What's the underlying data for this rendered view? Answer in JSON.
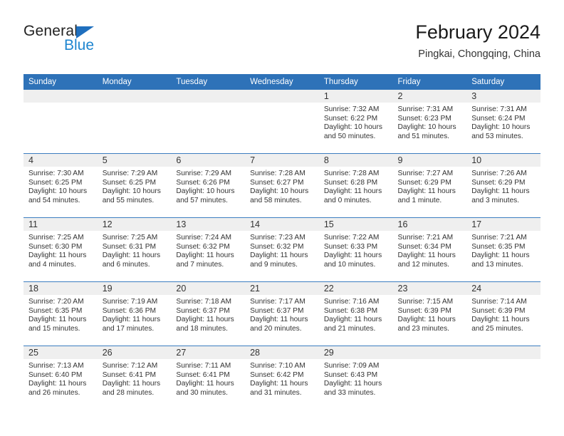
{
  "logo": {
    "word_top": "General",
    "word_bottom": "Blue",
    "triangle_color": "#1F6FBE",
    "blue_text_color": "#1F86D0"
  },
  "header": {
    "title": "February 2024",
    "subtitle": "Pingkai, Chongqing, China"
  },
  "theme": {
    "header_blue": "#2E72B8",
    "row_divider_blue": "#3C7EC0",
    "date_band_gray": "#EFEFEF",
    "text_color": "#333333"
  },
  "calendar": {
    "weekdays": [
      "Sunday",
      "Monday",
      "Tuesday",
      "Wednesday",
      "Thursday",
      "Friday",
      "Saturday"
    ],
    "weeks": [
      [
        {
          "date": "",
          "lines": []
        },
        {
          "date": "",
          "lines": []
        },
        {
          "date": "",
          "lines": []
        },
        {
          "date": "",
          "lines": []
        },
        {
          "date": "1",
          "lines": [
            "Sunrise: 7:32 AM",
            "Sunset: 6:22 PM",
            "Daylight: 10 hours and 50 minutes."
          ]
        },
        {
          "date": "2",
          "lines": [
            "Sunrise: 7:31 AM",
            "Sunset: 6:23 PM",
            "Daylight: 10 hours and 51 minutes."
          ]
        },
        {
          "date": "3",
          "lines": [
            "Sunrise: 7:31 AM",
            "Sunset: 6:24 PM",
            "Daylight: 10 hours and 53 minutes."
          ]
        }
      ],
      [
        {
          "date": "4",
          "lines": [
            "Sunrise: 7:30 AM",
            "Sunset: 6:25 PM",
            "Daylight: 10 hours and 54 minutes."
          ]
        },
        {
          "date": "5",
          "lines": [
            "Sunrise: 7:29 AM",
            "Sunset: 6:25 PM",
            "Daylight: 10 hours and 55 minutes."
          ]
        },
        {
          "date": "6",
          "lines": [
            "Sunrise: 7:29 AM",
            "Sunset: 6:26 PM",
            "Daylight: 10 hours and 57 minutes."
          ]
        },
        {
          "date": "7",
          "lines": [
            "Sunrise: 7:28 AM",
            "Sunset: 6:27 PM",
            "Daylight: 10 hours and 58 minutes."
          ]
        },
        {
          "date": "8",
          "lines": [
            "Sunrise: 7:28 AM",
            "Sunset: 6:28 PM",
            "Daylight: 11 hours and 0 minutes."
          ]
        },
        {
          "date": "9",
          "lines": [
            "Sunrise: 7:27 AM",
            "Sunset: 6:29 PM",
            "Daylight: 11 hours and 1 minute."
          ]
        },
        {
          "date": "10",
          "lines": [
            "Sunrise: 7:26 AM",
            "Sunset: 6:29 PM",
            "Daylight: 11 hours and 3 minutes."
          ]
        }
      ],
      [
        {
          "date": "11",
          "lines": [
            "Sunrise: 7:25 AM",
            "Sunset: 6:30 PM",
            "Daylight: 11 hours and 4 minutes."
          ]
        },
        {
          "date": "12",
          "lines": [
            "Sunrise: 7:25 AM",
            "Sunset: 6:31 PM",
            "Daylight: 11 hours and 6 minutes."
          ]
        },
        {
          "date": "13",
          "lines": [
            "Sunrise: 7:24 AM",
            "Sunset: 6:32 PM",
            "Daylight: 11 hours and 7 minutes."
          ]
        },
        {
          "date": "14",
          "lines": [
            "Sunrise: 7:23 AM",
            "Sunset: 6:32 PM",
            "Daylight: 11 hours and 9 minutes."
          ]
        },
        {
          "date": "15",
          "lines": [
            "Sunrise: 7:22 AM",
            "Sunset: 6:33 PM",
            "Daylight: 11 hours and 10 minutes."
          ]
        },
        {
          "date": "16",
          "lines": [
            "Sunrise: 7:21 AM",
            "Sunset: 6:34 PM",
            "Daylight: 11 hours and 12 minutes."
          ]
        },
        {
          "date": "17",
          "lines": [
            "Sunrise: 7:21 AM",
            "Sunset: 6:35 PM",
            "Daylight: 11 hours and 13 minutes."
          ]
        }
      ],
      [
        {
          "date": "18",
          "lines": [
            "Sunrise: 7:20 AM",
            "Sunset: 6:35 PM",
            "Daylight: 11 hours and 15 minutes."
          ]
        },
        {
          "date": "19",
          "lines": [
            "Sunrise: 7:19 AM",
            "Sunset: 6:36 PM",
            "Daylight: 11 hours and 17 minutes."
          ]
        },
        {
          "date": "20",
          "lines": [
            "Sunrise: 7:18 AM",
            "Sunset: 6:37 PM",
            "Daylight: 11 hours and 18 minutes."
          ]
        },
        {
          "date": "21",
          "lines": [
            "Sunrise: 7:17 AM",
            "Sunset: 6:37 PM",
            "Daylight: 11 hours and 20 minutes."
          ]
        },
        {
          "date": "22",
          "lines": [
            "Sunrise: 7:16 AM",
            "Sunset: 6:38 PM",
            "Daylight: 11 hours and 21 minutes."
          ]
        },
        {
          "date": "23",
          "lines": [
            "Sunrise: 7:15 AM",
            "Sunset: 6:39 PM",
            "Daylight: 11 hours and 23 minutes."
          ]
        },
        {
          "date": "24",
          "lines": [
            "Sunrise: 7:14 AM",
            "Sunset: 6:39 PM",
            "Daylight: 11 hours and 25 minutes."
          ]
        }
      ],
      [
        {
          "date": "25",
          "lines": [
            "Sunrise: 7:13 AM",
            "Sunset: 6:40 PM",
            "Daylight: 11 hours and 26 minutes."
          ]
        },
        {
          "date": "26",
          "lines": [
            "Sunrise: 7:12 AM",
            "Sunset: 6:41 PM",
            "Daylight: 11 hours and 28 minutes."
          ]
        },
        {
          "date": "27",
          "lines": [
            "Sunrise: 7:11 AM",
            "Sunset: 6:41 PM",
            "Daylight: 11 hours and 30 minutes."
          ]
        },
        {
          "date": "28",
          "lines": [
            "Sunrise: 7:10 AM",
            "Sunset: 6:42 PM",
            "Daylight: 11 hours and 31 minutes."
          ]
        },
        {
          "date": "29",
          "lines": [
            "Sunrise: 7:09 AM",
            "Sunset: 6:43 PM",
            "Daylight: 11 hours and 33 minutes."
          ]
        },
        {
          "date": "",
          "lines": []
        },
        {
          "date": "",
          "lines": []
        }
      ]
    ]
  }
}
